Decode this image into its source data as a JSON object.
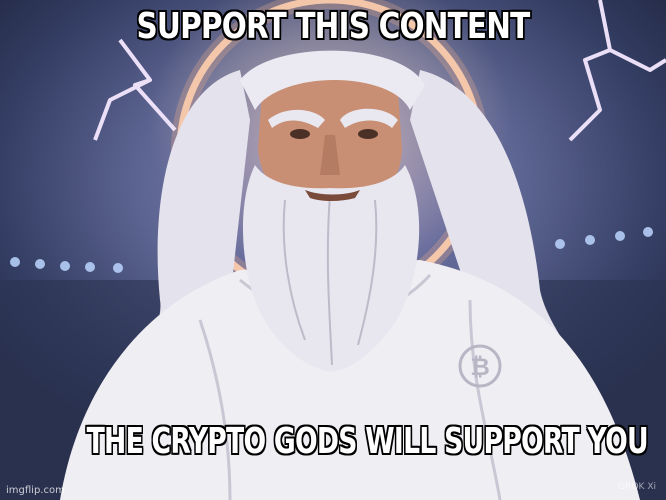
{
  "meme": {
    "top_text": "SUPPORT THIS CONTENT",
    "bottom_text": "THE CRYPTO GODS WILL SUPPORT YOU",
    "watermark": "imgflip.com",
    "generator_mark": "GROK Xi"
  },
  "illustration": {
    "subject": "bearded-god-figure",
    "emblem_icon": "bitcoin-icon",
    "colors": {
      "sky": "#5d6592",
      "halo": "#ffd6b8",
      "lightning": "#f4e8ff",
      "hair": "#e8e6ee",
      "robe": "#f1f0f4",
      "skin": "#c88f74"
    }
  }
}
